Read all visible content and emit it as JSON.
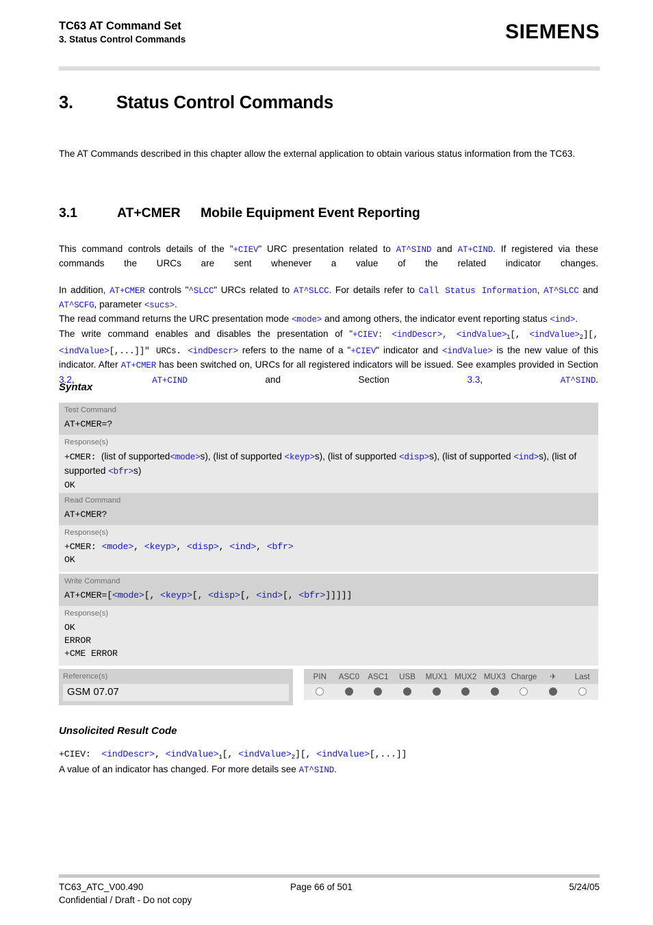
{
  "header": {
    "title": "TC63 AT Command Set",
    "subtitle": "3. Status Control Commands",
    "brand": "SIEMENS"
  },
  "chapter": {
    "number": "3.",
    "title": "Status Control Commands",
    "intro": "The AT Commands described in this chapter allow the external application to obtain various status information from the TC63."
  },
  "section": {
    "number": "3.1",
    "command": "AT+CMER",
    "title": "Mobile Equipment Event Reporting"
  },
  "description": {
    "p1_a": "This command controls details of the \"",
    "p1_ciev": "+CIEV",
    "p1_b": "\" URC presentation related to ",
    "p1_sind": "AT^SIND",
    "p1_c": " and ",
    "p1_cind": "AT+CIND",
    "p1_d": ". If registered via these commands the URCs are sent whenever a value of the related indicator changes.",
    "p2_a": "In addition, ",
    "p2_cmer": "AT+CMER",
    "p2_b": " controls \"",
    "p2_slcc_q": "^SLCC",
    "p2_c": "\" URCs related to ",
    "p2_slcc": "AT^SLCC",
    "p2_d": ". For details refer to ",
    "p2_callstatus": "Call Status Information",
    "p2_e": ", ",
    "p2_slcc2": "AT^SLCC",
    "p2_f": " and ",
    "p2_scfg": "AT^SCFG",
    "p2_g": ", parameter ",
    "p2_sucs": "<sucs>",
    "p2_h": ".",
    "p3_a": "The read command returns the URC presentation mode ",
    "p3_mode": "<mode>",
    "p3_b": " and among others, the indicator event reporting status ",
    "p3_ind": "<ind>",
    "p3_c": ".",
    "p4_a": "The write command enables and disables the presentation of \"",
    "p4_ciev": "+CIEV",
    "p4_b": ": ",
    "p4_inddescr": "<indDescr>",
    "p4_c": ", ",
    "p4_indvalue1": "<indValue>",
    "p4_sub1": "1",
    "p4_d": "[, ",
    "p4_indvalue2": "<indValue>",
    "p4_sub2": "2",
    "p4_e": "][, ",
    "p4_indvalue3": "<indValue>",
    "p4_f": "[,...]]\" URCs. ",
    "p4_inddescr2": "<indDescr>",
    "p4_g": " refers to the name of a \"",
    "p4_ciev2": "+CIEV",
    "p4_h": "\" indicator and ",
    "p4_indvalue4": "<indValue>",
    "p4_i": " is the new value of this indicator. After ",
    "p4_cmer": "AT+CMER",
    "p4_j": " has been switched on, URCs for all registered indicators will be issued. See examples provided in Section ",
    "p4_sec32": "3.2",
    "p4_k": ", ",
    "p4_cind": "AT+CIND",
    "p4_l": " and Section ",
    "p4_sec33": "3.3",
    "p4_m": ", ",
    "p4_sind": "AT^SIND",
    "p4_n": "."
  },
  "syntax": {
    "heading": "Syntax",
    "test": {
      "label": "Test Command",
      "command": "AT+CMER=?",
      "response_label": "Response(s)",
      "resp_prefix": "+CMER:",
      "r_a": "(list of supported",
      "r_mode": "<mode>",
      "r_b": "s), (list of supported ",
      "r_keyp": "<keyp>",
      "r_c": "s), (list of supported ",
      "r_disp": "<disp>",
      "r_d": "s), (list of supported ",
      "r_ind": "<ind>",
      "r_e": "s), (list of supported ",
      "r_bfr": "<bfr>",
      "r_f": "s)",
      "ok": "OK"
    },
    "read": {
      "label": "Read Command",
      "command": "AT+CMER?",
      "response_label": "Response(s)",
      "resp_prefix": "+CMER:",
      "mode": "<mode>",
      "keyp": "<keyp>",
      "disp": "<disp>",
      "ind": "<ind>",
      "bfr": "<bfr>",
      "sep": ", ",
      "ok": "OK"
    },
    "write": {
      "label": "Write Command",
      "cmd_prefix": "AT+CMER=[",
      "mode": "<mode>",
      "s1": "[, ",
      "keyp": "<keyp>",
      "s2": "[, ",
      "disp": "<disp>",
      "s3": "[, ",
      "ind": "<ind>",
      "s4": "[, ",
      "bfr": "<bfr>",
      "s5": "]]]]]",
      "response_label": "Response(s)",
      "ok": "OK",
      "error": "ERROR",
      "cme_error": "+CME ERROR"
    }
  },
  "reference": {
    "label": "Reference(s)",
    "value": "GSM 07.07"
  },
  "capabilities": {
    "columns": [
      "PIN",
      "ASC0",
      "ASC1",
      "USB",
      "MUX1",
      "MUX2",
      "MUX3",
      "Charge",
      "airplane-icon",
      "Last"
    ],
    "states": [
      "empty",
      "filled",
      "filled",
      "filled",
      "filled",
      "filled",
      "filled",
      "empty",
      "filled",
      "empty"
    ],
    "airplane_glyph": "✈"
  },
  "urc": {
    "heading": "Unsolicited Result Code",
    "prefix": "+CIEV:",
    "u_a": " ",
    "u_inddescr": "<indDescr>",
    "u_b": ", ",
    "u_indvalue1": "<indValue>",
    "u_sub1": "1",
    "u_c": "[, ",
    "u_indvalue2": "<indValue>",
    "u_sub2": "2",
    "u_d": "][, ",
    "u_indvalue3": "<indValue>",
    "u_e": "[,...]]",
    "desc_a": "A value of an indicator has changed. For more details see ",
    "desc_sind": "AT^SIND",
    "desc_b": "."
  },
  "footer": {
    "doc_id": "TC63_ATC_V00.490",
    "page": "Page 66 of 501",
    "date": "5/24/05",
    "confidential": "Confidential / Draft - Do not copy"
  }
}
